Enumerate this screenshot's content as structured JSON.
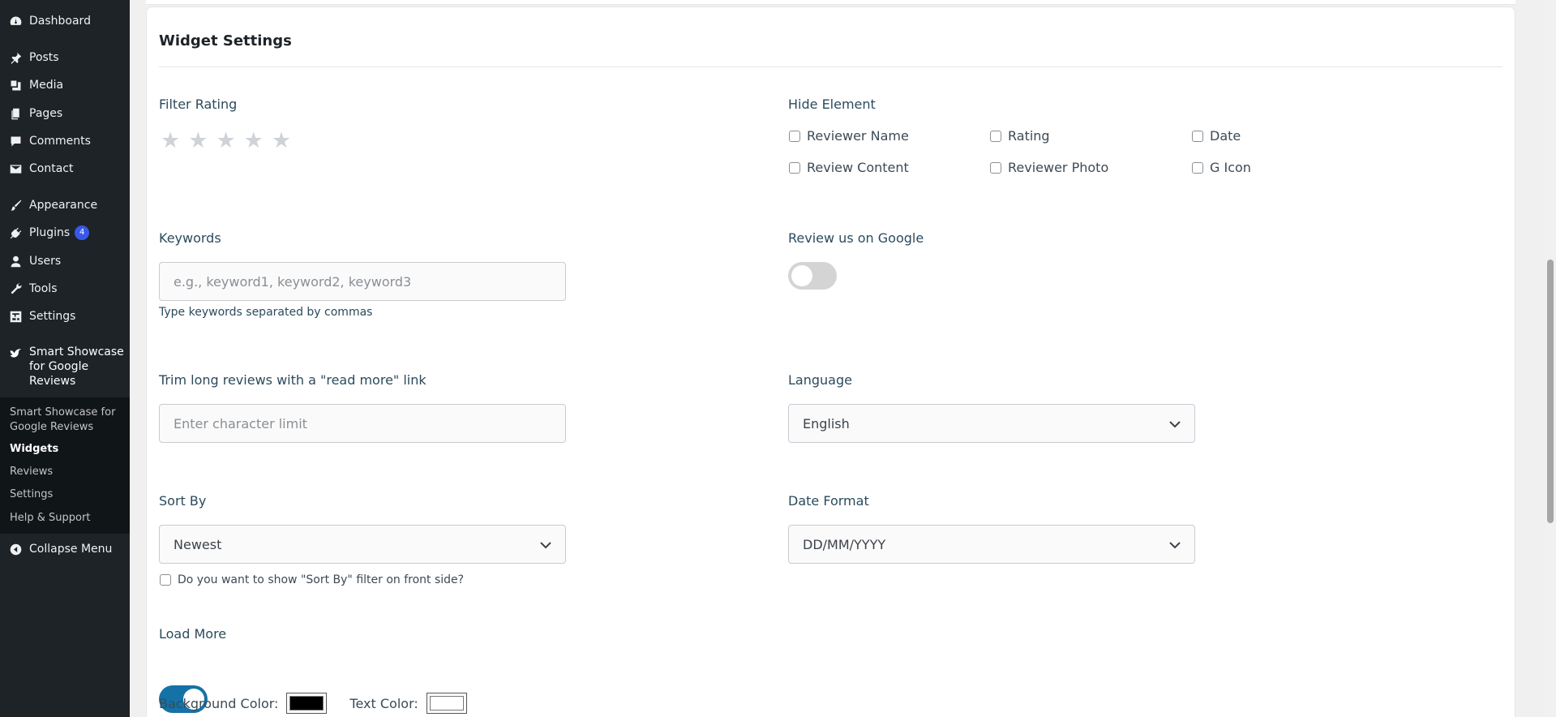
{
  "sidebar": {
    "items": [
      {
        "label": "Dashboard",
        "icon": "dashboard-icon"
      },
      {
        "label": "Posts",
        "icon": "pin-icon"
      },
      {
        "label": "Media",
        "icon": "media-icon"
      },
      {
        "label": "Pages",
        "icon": "pages-icon"
      },
      {
        "label": "Comments",
        "icon": "comment-icon"
      },
      {
        "label": "Contact",
        "icon": "mail-icon"
      },
      {
        "label": "Appearance",
        "icon": "brush-icon"
      },
      {
        "label": "Plugins",
        "icon": "plugin-icon",
        "badge": "4"
      },
      {
        "label": "Users",
        "icon": "user-icon"
      },
      {
        "label": "Tools",
        "icon": "wrench-icon"
      },
      {
        "label": "Settings",
        "icon": "settings-icon"
      }
    ],
    "active_plugin": {
      "label_line1": "Smart Showcase",
      "label_line2": "for Google",
      "label_line3": "Reviews",
      "icon": "bird-icon"
    },
    "submenu": [
      {
        "label_line1": "Smart Showcase for",
        "label_line2": "Google Reviews"
      },
      {
        "label": "Widgets",
        "current": true
      },
      {
        "label": "Reviews"
      },
      {
        "label": "Settings"
      },
      {
        "label": "Help & Support"
      }
    ],
    "collapse_label": "Collapse Menu"
  },
  "card": {
    "title": "Widget Settings",
    "filter_rating": {
      "label": "Filter Rating",
      "rating": 0,
      "max": 5
    },
    "hide_element": {
      "label": "Hide Element",
      "options": [
        "Reviewer Name",
        "Rating",
        "Date",
        "Review Content",
        "Reviewer Photo",
        "G Icon"
      ]
    },
    "keywords": {
      "label": "Keywords",
      "placeholder": "e.g., keyword1, keyword2, keyword3",
      "help": "Type keywords separated by commas"
    },
    "review_google": {
      "label": "Review us on Google",
      "enabled": false
    },
    "trim": {
      "label": "Trim long reviews with a \"read more\" link",
      "placeholder": "Enter character limit"
    },
    "language": {
      "label": "Language",
      "value": "English"
    },
    "sort_by": {
      "label": "Sort By",
      "value": "Newest",
      "checkbox_label": "Do you want to show \"Sort By\" filter on front side?"
    },
    "date_format": {
      "label": "Date Format",
      "value": "DD/MM/YYYY"
    },
    "load_more": {
      "label": "Load More",
      "enabled": true,
      "bg_color_label": "Background Color:",
      "text_color_label": "Text Color:",
      "bg_color": "#000000",
      "text_color": "#ffffff"
    }
  },
  "colors": {
    "sidebar_bg": "#1d2327",
    "accent": "#1572a6",
    "badge": "#3858e9"
  }
}
